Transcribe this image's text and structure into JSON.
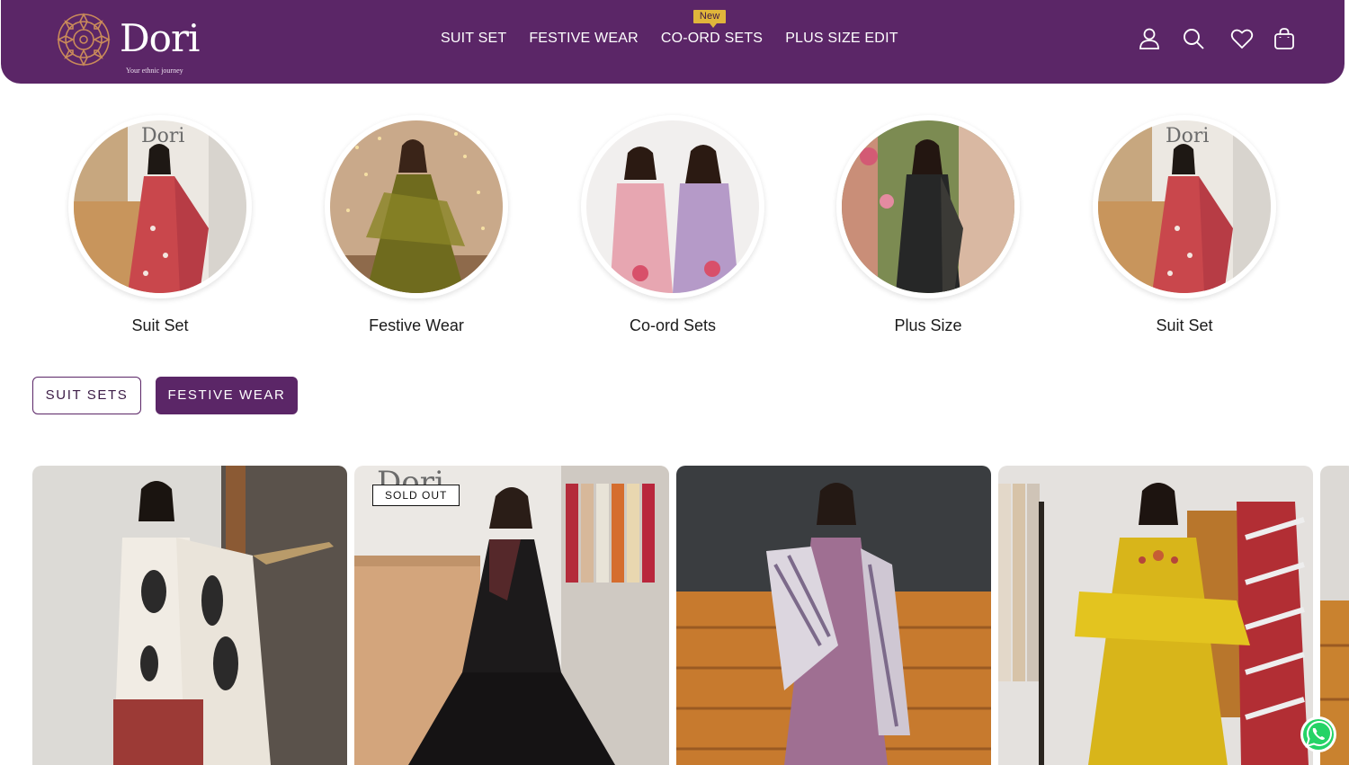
{
  "brand": {
    "name": "Dori",
    "tagline": "Your ethnic journey"
  },
  "nav": {
    "items": [
      {
        "label": "SUIT SET"
      },
      {
        "label": "FESTIVE WEAR"
      },
      {
        "label": "CO-ORD SETS",
        "badge": "New"
      },
      {
        "label": "PLUS SIZE EDIT"
      }
    ]
  },
  "header_icons": [
    "account-icon",
    "search-icon",
    "wishlist-heart-icon",
    "cart-bag-icon"
  ],
  "categories": [
    {
      "label": "Suit Set"
    },
    {
      "label": "Festive Wear"
    },
    {
      "label": "Co-ord Sets"
    },
    {
      "label": "Plus Size"
    },
    {
      "label": "Suit Set"
    }
  ],
  "tabs": [
    {
      "label": "SUIT SETS",
      "active": false
    },
    {
      "label": "FESTIVE WEAR",
      "active": true
    }
  ],
  "products": [
    {
      "badge": ""
    },
    {
      "badge": "SOLD OUT"
    },
    {
      "badge": ""
    },
    {
      "badge": ""
    }
  ],
  "colors": {
    "brand_purple": "#5b2667",
    "badge_gold": "#e0b53b",
    "whatsapp_green": "#25d366"
  }
}
